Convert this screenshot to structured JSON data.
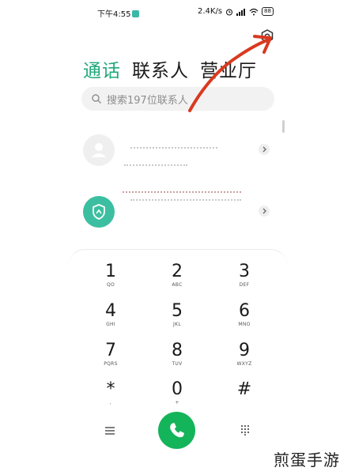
{
  "status_bar": {
    "time": "下午4:55",
    "net_speed": "2.4K/s",
    "battery": "88"
  },
  "tabs": [
    {
      "label": "通话",
      "active": true
    },
    {
      "label": "联系人",
      "active": false
    },
    {
      "label": "营业厅",
      "active": false
    }
  ],
  "search": {
    "placeholder": "搜索197位联系人"
  },
  "keypad": {
    "keys": [
      {
        "digit": "1",
        "letters": "QO"
      },
      {
        "digit": "2",
        "letters": "ABC"
      },
      {
        "digit": "3",
        "letters": "DEF"
      },
      {
        "digit": "4",
        "letters": "GHI"
      },
      {
        "digit": "5",
        "letters": "JKL"
      },
      {
        "digit": "6",
        "letters": "MNO"
      },
      {
        "digit": "7",
        "letters": "PQRS"
      },
      {
        "digit": "8",
        "letters": "TUV"
      },
      {
        "digit": "9",
        "letters": "WXYZ"
      },
      {
        "digit": "*",
        "letters": ","
      },
      {
        "digit": "0",
        "letters": "+"
      },
      {
        "digit": "#",
        "letters": ""
      }
    ]
  },
  "colors": {
    "accent": "#1fa87a",
    "call_button": "#14b45a",
    "annotation_arrow": "#d9391f"
  },
  "icons": [
    "settings-icon",
    "search-icon",
    "menu-icon",
    "call-icon",
    "dialpad-icon",
    "person-icon",
    "shield-icon",
    "chevron-right-icon"
  ],
  "watermark": "煎蛋手游"
}
